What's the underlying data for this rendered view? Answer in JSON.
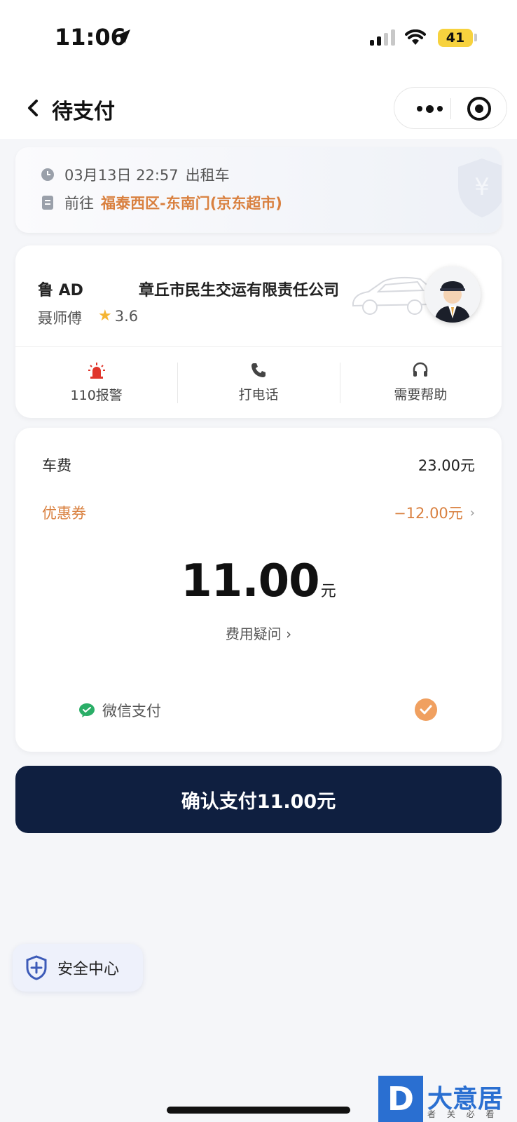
{
  "status_bar": {
    "time": "11:06",
    "battery": "41"
  },
  "navbar": {
    "title": "待支付"
  },
  "trip": {
    "datetime": "03月13日 22:57",
    "ride_type": "出租车",
    "dest_label": "前往",
    "destination": "福泰西区-东南门(京东超市)"
  },
  "driver": {
    "plate": "鲁 AD",
    "company": "章丘市民生交运有限责任公司",
    "name": "聂师傅",
    "rating": "3.6",
    "actions": [
      {
        "label": "110报警",
        "icon": "alarm-icon",
        "color": "#e0352b"
      },
      {
        "label": "打电话",
        "icon": "phone-icon"
      },
      {
        "label": "需要帮助",
        "icon": "headset-icon"
      }
    ]
  },
  "fee": {
    "fare_label": "车费",
    "fare_value": "23.00元",
    "coupon_label": "优惠券",
    "coupon_value": "−12.00元",
    "total_amount": "11.00",
    "total_unit": "元",
    "query_label": "费用疑问",
    "payment_method": "微信支付"
  },
  "confirm_label": "确认支付11.00元",
  "safety_label": "安全中心",
  "watermark": {
    "letter": "D",
    "text": "大意居",
    "sub": "者 关 必 看"
  },
  "colors": {
    "accent": "#d9803f",
    "primary_dark": "#0f1f40",
    "check": "#f0a060",
    "wechat": "#2aae67"
  }
}
